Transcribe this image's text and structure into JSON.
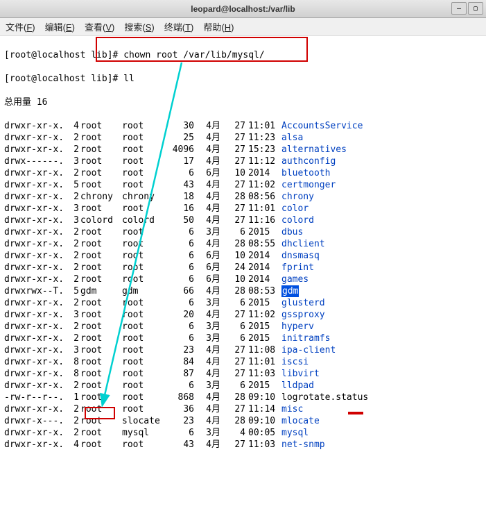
{
  "titlebar": "leopard@localhost:/var/lib",
  "menubar": [
    {
      "label": "文件",
      "accel": "F"
    },
    {
      "label": "编辑",
      "accel": "E"
    },
    {
      "label": "查看",
      "accel": "V"
    },
    {
      "label": "搜索",
      "accel": "S"
    },
    {
      "label": "终端",
      "accel": "T"
    },
    {
      "label": "帮助",
      "accel": "H"
    }
  ],
  "prompt": "[root@localhost lib]# ",
  "cmd1": "chown root /var/lib/mysql/",
  "cmd2": "ll",
  "total_label": "总用量 16",
  "listing": [
    {
      "perm": "drwxr-xr-x.",
      "links": "4",
      "owner": "root",
      "group": "root",
      "size": "30",
      "month": "4月",
      "day": "27",
      "time": "11:01",
      "name": "AccountsService",
      "type": "dir"
    },
    {
      "perm": "drwxr-xr-x.",
      "links": "2",
      "owner": "root",
      "group": "root",
      "size": "25",
      "month": "4月",
      "day": "27",
      "time": "11:23",
      "name": "alsa",
      "type": "dir"
    },
    {
      "perm": "drwxr-xr-x.",
      "links": "2",
      "owner": "root",
      "group": "root",
      "size": "4096",
      "month": "4月",
      "day": "27",
      "time": "15:23",
      "name": "alternatives",
      "type": "dir"
    },
    {
      "perm": "drwx------.",
      "links": "3",
      "owner": "root",
      "group": "root",
      "size": "17",
      "month": "4月",
      "day": "27",
      "time": "11:12",
      "name": "authconfig",
      "type": "dir"
    },
    {
      "perm": "drwxr-xr-x.",
      "links": "2",
      "owner": "root",
      "group": "root",
      "size": "6",
      "month": "6月",
      "day": "10",
      "time": "2014",
      "name": "bluetooth",
      "type": "dir"
    },
    {
      "perm": "drwxr-xr-x.",
      "links": "5",
      "owner": "root",
      "group": "root",
      "size": "43",
      "month": "4月",
      "day": "27",
      "time": "11:02",
      "name": "certmonger",
      "type": "dir"
    },
    {
      "perm": "drwxr-xr-x.",
      "links": "2",
      "owner": "chrony",
      "group": "chrony",
      "size": "18",
      "month": "4月",
      "day": "28",
      "time": "08:56",
      "name": "chrony",
      "type": "dir"
    },
    {
      "perm": "drwxr-xr-x.",
      "links": "3",
      "owner": "root",
      "group": "root",
      "size": "16",
      "month": "4月",
      "day": "27",
      "time": "11:01",
      "name": "color",
      "type": "dir"
    },
    {
      "perm": "drwxr-xr-x.",
      "links": "3",
      "owner": "colord",
      "group": "colord",
      "size": "50",
      "month": "4月",
      "day": "27",
      "time": "11:16",
      "name": "colord",
      "type": "dir"
    },
    {
      "perm": "drwxr-xr-x.",
      "links": "2",
      "owner": "root",
      "group": "root",
      "size": "6",
      "month": "3月",
      "day": "6",
      "time": "2015",
      "name": "dbus",
      "type": "dir"
    },
    {
      "perm": "drwxr-xr-x.",
      "links": "2",
      "owner": "root",
      "group": "root",
      "size": "6",
      "month": "4月",
      "day": "28",
      "time": "08:55",
      "name": "dhclient",
      "type": "dir"
    },
    {
      "perm": "drwxr-xr-x.",
      "links": "2",
      "owner": "root",
      "group": "root",
      "size": "6",
      "month": "6月",
      "day": "10",
      "time": "2014",
      "name": "dnsmasq",
      "type": "dir"
    },
    {
      "perm": "drwxr-xr-x.",
      "links": "2",
      "owner": "root",
      "group": "root",
      "size": "6",
      "month": "6月",
      "day": "24",
      "time": "2014",
      "name": "fprint",
      "type": "dir"
    },
    {
      "perm": "drwxr-xr-x.",
      "links": "2",
      "owner": "root",
      "group": "root",
      "size": "6",
      "month": "6月",
      "day": "10",
      "time": "2014",
      "name": "games",
      "type": "dir"
    },
    {
      "perm": "drwxrwx--T.",
      "links": "5",
      "owner": "gdm",
      "group": "gdm",
      "size": "66",
      "month": "4月",
      "day": "28",
      "time": "08:53",
      "name": "gdm",
      "type": "hl"
    },
    {
      "perm": "drwxr-xr-x.",
      "links": "2",
      "owner": "root",
      "group": "root",
      "size": "6",
      "month": "3月",
      "day": "6",
      "time": "2015",
      "name": "glusterd",
      "type": "dir"
    },
    {
      "perm": "drwxr-xr-x.",
      "links": "3",
      "owner": "root",
      "group": "root",
      "size": "20",
      "month": "4月",
      "day": "27",
      "time": "11:02",
      "name": "gssproxy",
      "type": "dir"
    },
    {
      "perm": "drwxr-xr-x.",
      "links": "2",
      "owner": "root",
      "group": "root",
      "size": "6",
      "month": "3月",
      "day": "6",
      "time": "2015",
      "name": "hyperv",
      "type": "dir"
    },
    {
      "perm": "drwxr-xr-x.",
      "links": "2",
      "owner": "root",
      "group": "root",
      "size": "6",
      "month": "3月",
      "day": "6",
      "time": "2015",
      "name": "initramfs",
      "type": "dir"
    },
    {
      "perm": "drwxr-xr-x.",
      "links": "3",
      "owner": "root",
      "group": "root",
      "size": "23",
      "month": "4月",
      "day": "27",
      "time": "11:08",
      "name": "ipa-client",
      "type": "dir"
    },
    {
      "perm": "drwxr-xr-x.",
      "links": "8",
      "owner": "root",
      "group": "root",
      "size": "84",
      "month": "4月",
      "day": "27",
      "time": "11:01",
      "name": "iscsi",
      "type": "dir"
    },
    {
      "perm": "drwxr-xr-x.",
      "links": "8",
      "owner": "root",
      "group": "root",
      "size": "87",
      "month": "4月",
      "day": "27",
      "time": "11:03",
      "name": "libvirt",
      "type": "dir"
    },
    {
      "perm": "drwxr-xr-x.",
      "links": "2",
      "owner": "root",
      "group": "root",
      "size": "6",
      "month": "3月",
      "day": "6",
      "time": "2015",
      "name": "lldpad",
      "type": "dir"
    },
    {
      "perm": "-rw-r--r--.",
      "links": "1",
      "owner": "root",
      "group": "root",
      "size": "868",
      "month": "4月",
      "day": "28",
      "time": "09:10",
      "name": "logrotate.status",
      "type": "file"
    },
    {
      "perm": "drwxr-xr-x.",
      "links": "2",
      "owner": "root",
      "group": "root",
      "size": "36",
      "month": "4月",
      "day": "27",
      "time": "11:14",
      "name": "misc",
      "type": "dir"
    },
    {
      "perm": "drwxr-x---.",
      "links": "2",
      "owner": "root",
      "group": "slocate",
      "size": "23",
      "month": "4月",
      "day": "28",
      "time": "09:10",
      "name": "mlocate",
      "type": "dir"
    },
    {
      "perm": "drwxr-xr-x.",
      "links": "2",
      "owner": "root",
      "group": "mysql",
      "size": "6",
      "month": "3月",
      "day": "4",
      "time": "00:05",
      "name": "mysql",
      "type": "dir"
    },
    {
      "perm": "drwxr-xr-x.",
      "links": "4",
      "owner": "root",
      "group": "root",
      "size": "43",
      "month": "4月",
      "day": "27",
      "time": "11:03",
      "name": "net-snmp",
      "type": "dir"
    }
  ]
}
